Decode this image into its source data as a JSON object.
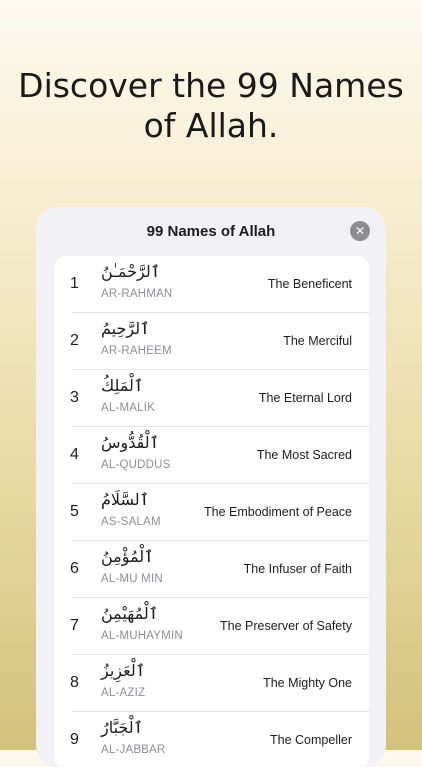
{
  "headline": "Discover the 99 Names of Allah.",
  "sheet": {
    "title": "99 Names of Allah",
    "close_icon": "close-icon"
  },
  "names": [
    {
      "number": "1",
      "arabic": "ٱلرَّحْمَـٰنُ",
      "transliteration": "AR-RAHMAN",
      "meaning": "The Beneficent"
    },
    {
      "number": "2",
      "arabic": "ٱلرَّحِيمُ",
      "transliteration": "AR-RAHEEM",
      "meaning": "The Merciful"
    },
    {
      "number": "3",
      "arabic": "ٱلْمَلِكُ",
      "transliteration": "AL-MALIK",
      "meaning": "The Eternal Lord"
    },
    {
      "number": "4",
      "arabic": "ٱلْقُدُّوسُ",
      "transliteration": "AL-QUDDUS",
      "meaning": "The Most Sacred"
    },
    {
      "number": "5",
      "arabic": "ٱلسَّلَامُ",
      "transliteration": "AS-SALAM",
      "meaning": "The Embodiment of Peace"
    },
    {
      "number": "6",
      "arabic": "ٱلْمُؤْمِنُ",
      "transliteration": "AL-MU MIN",
      "meaning": "The Infuser of Faith"
    },
    {
      "number": "7",
      "arabic": "ٱلْمُهَيْمِنُ",
      "transliteration": "AL-MUHAYMIN",
      "meaning": "The Preserver of Safety"
    },
    {
      "number": "8",
      "arabic": "ٱلْعَزِيزُ",
      "transliteration": "AL-AZIZ",
      "meaning": "The Mighty One"
    },
    {
      "number": "9",
      "arabic": "ٱلْجَبَّارُ",
      "transliteration": "AL-JABBAR",
      "meaning": "The Compeller"
    }
  ]
}
